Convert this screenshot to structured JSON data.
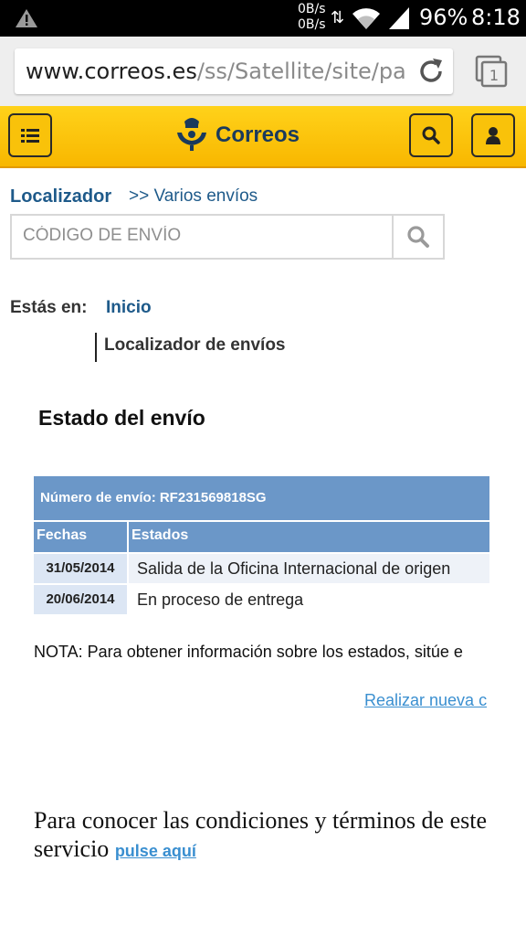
{
  "statusbar": {
    "speed_up": "0B/s",
    "speed_down": "0B/s",
    "arrows": "⇅",
    "battery": "96%",
    "clock": "8:18"
  },
  "browser": {
    "url_host": "www.correos.es",
    "url_path": "/ss/Satellite/site/pa",
    "tab_count": "1"
  },
  "header": {
    "brand": "Correos",
    "brand_color": "#1a3a5c",
    "header_color": "#f8c000"
  },
  "localizador": {
    "title": "Localizador",
    "link": ">> Varios envíos",
    "search_placeholder": "CÓDIGO DE ENVÍO"
  },
  "breadcrumb": {
    "label": "Estás en:",
    "home": "Inicio",
    "current": "Localizador de envíos"
  },
  "section_title": "Estado del envío",
  "table": {
    "shipment_number": "Número de envío: RF231569818SG",
    "headers": [
      "Fechas",
      "Estados"
    ],
    "rows": [
      {
        "date": "31/05/2014",
        "status": "Salida de la Oficina Internacional de origen"
      },
      {
        "date": "20/06/2014",
        "status": "En proceso de entrega"
      }
    ],
    "header_color": "#6b97c8"
  },
  "nota": "NOTA: Para obtener información sobre los estados, sitúe e",
  "new_search_link": "Realizar nueva c",
  "conditions": {
    "text": "Para conocer las condiciones y términos de este servicio",
    "link": "pulse aquí"
  }
}
